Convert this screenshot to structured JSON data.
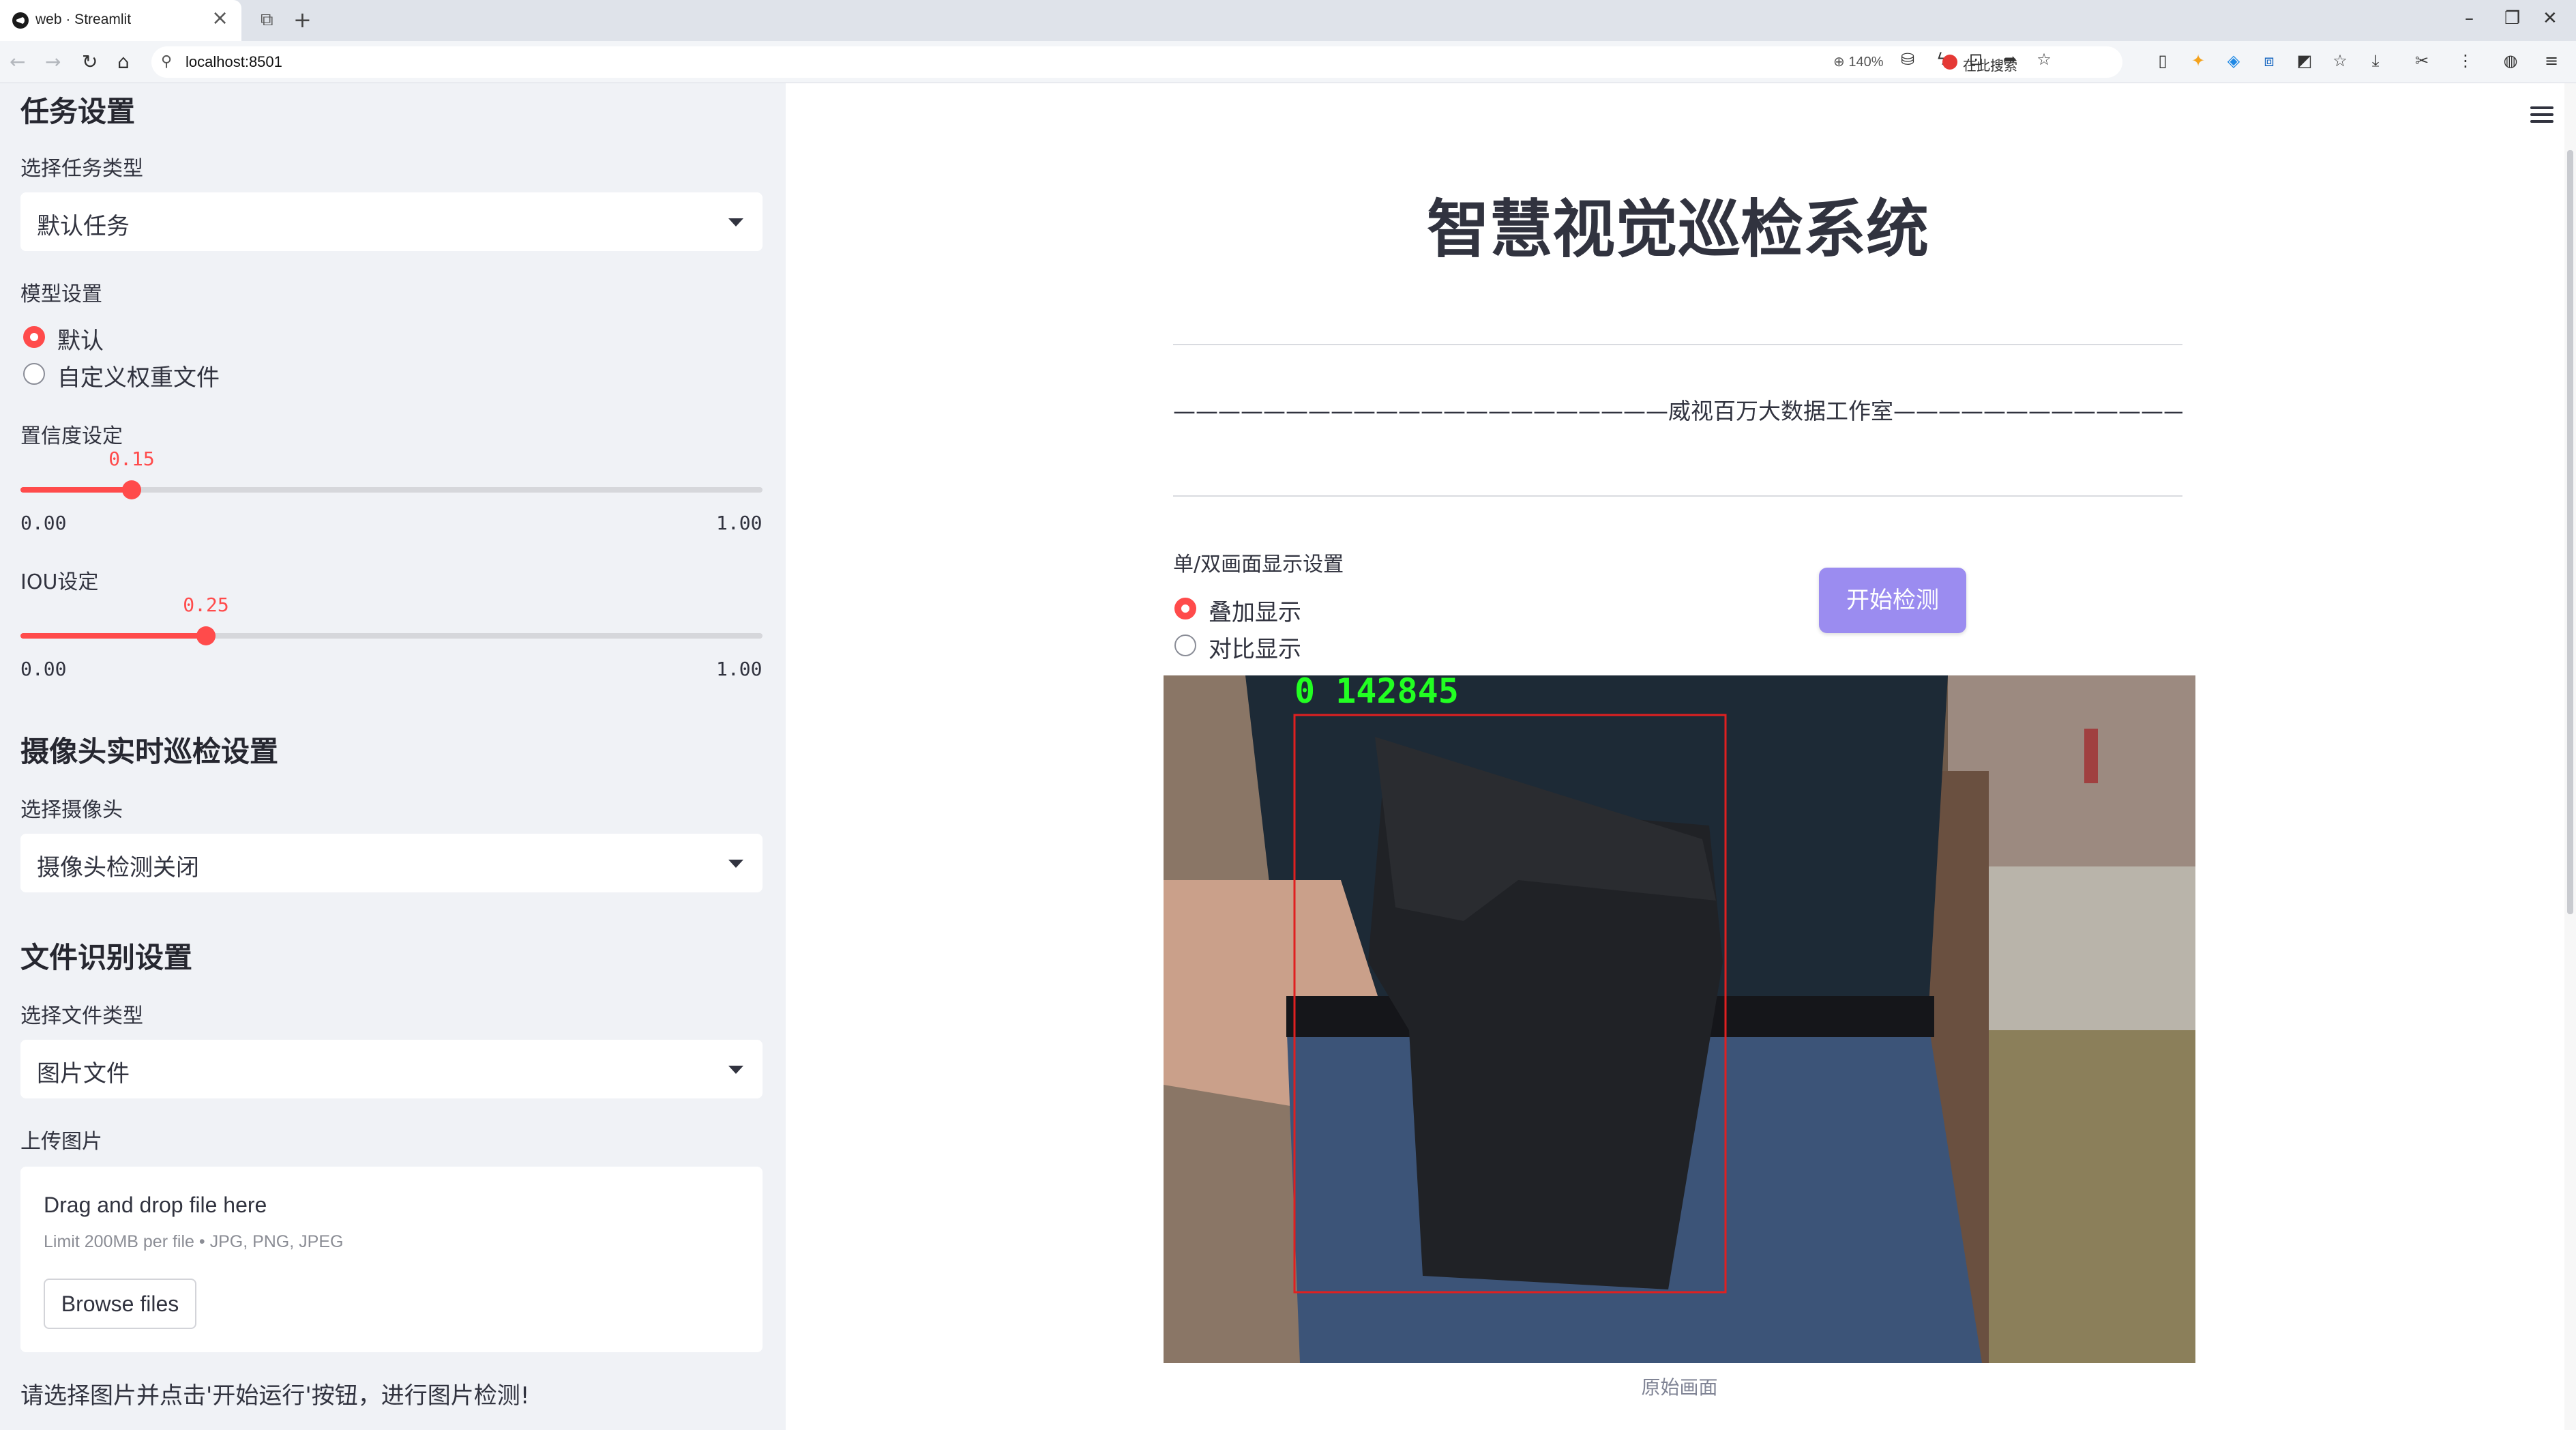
{
  "browser": {
    "tab_title": "web · Streamlit",
    "url": "localhost:8501",
    "zoom": "140%",
    "search_label": "在此搜索",
    "close_glyph": "×",
    "new_tab_glyph": "+"
  },
  "sidebar": {
    "task_header": "任务设置",
    "task_type_label": "选择任务类型",
    "task_type_value": "默认任务",
    "model_label": "模型设置",
    "model_options": [
      "默认",
      "自定义权重文件"
    ],
    "model_selected": 0,
    "confidence": {
      "label": "置信度设定",
      "value": "0.15",
      "min": "0.00",
      "max": "1.00",
      "fraction": 0.15
    },
    "iou": {
      "label": "IOU设定",
      "value": "0.25",
      "min": "0.00",
      "max": "1.00",
      "fraction": 0.25
    },
    "camera_header": "摄像头实时巡检设置",
    "camera_label": "选择摄像头",
    "camera_value": "摄像头检测关闭",
    "file_header": "文件识别设置",
    "file_type_label": "选择文件类型",
    "file_type_value": "图片文件",
    "upload_label": "上传图片",
    "upload_title": "Drag and drop file here",
    "upload_limit": "Limit 200MB per file • JPG, PNG, JPEG",
    "browse_label": "Browse files",
    "note": "请选择图片并点击'开始运行'按钮，进行图片检测!"
  },
  "main": {
    "title": "智慧视觉巡检系统",
    "subtitle": "——————————————————————威视百万大数据工作室——————————————————————",
    "display_label": "单/双画面显示设置",
    "display_options": [
      "叠加显示",
      "对比显示"
    ],
    "display_selected": 0,
    "start_button": "开始检测",
    "detection_label": "0 142845",
    "image_caption": "原始画面"
  },
  "colors": {
    "accent": "#ff4b4b",
    "button": "#9b8cf0",
    "sidebar_bg": "#f0f2f6",
    "detection_box": "#e02020",
    "detection_text": "#22ff22"
  },
  "icons": [
    "back-icon",
    "forward-icon",
    "reload-icon",
    "home-icon",
    "lock-icon",
    "zoom-icon",
    "menu-icon",
    "chevron-down-icon"
  ]
}
